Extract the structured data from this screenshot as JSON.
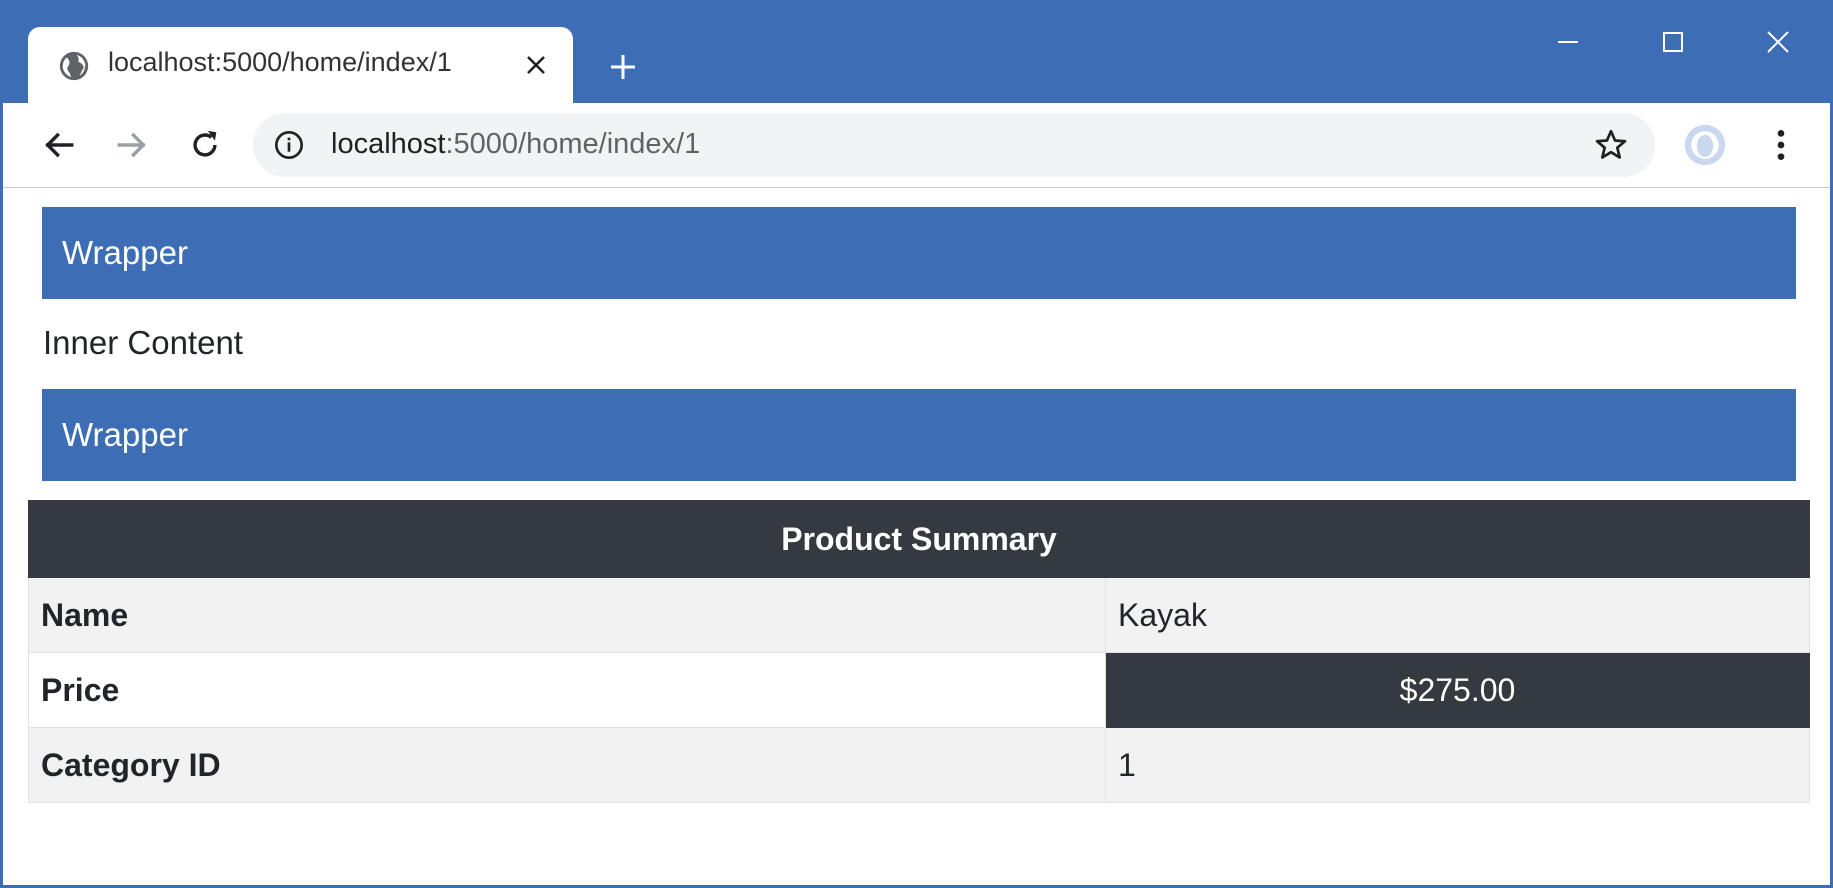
{
  "browser": {
    "tab_title": "localhost:5000/home/index/1",
    "address": {
      "host": "localhost",
      "path": ":5000/home/index/1"
    }
  },
  "page": {
    "wrapper_top": "Wrapper",
    "inner_content": "Inner Content",
    "wrapper_bottom": "Wrapper",
    "table": {
      "heading": "Product Summary",
      "rows": [
        {
          "label": "Name",
          "value": "Kayak"
        },
        {
          "label": "Price",
          "value": "$275.00"
        },
        {
          "label": "Category ID",
          "value": "1"
        }
      ]
    }
  },
  "colors": {
    "accent": "#3d6db5",
    "dark": "#343a40",
    "stripe": "#f2f2f2"
  }
}
